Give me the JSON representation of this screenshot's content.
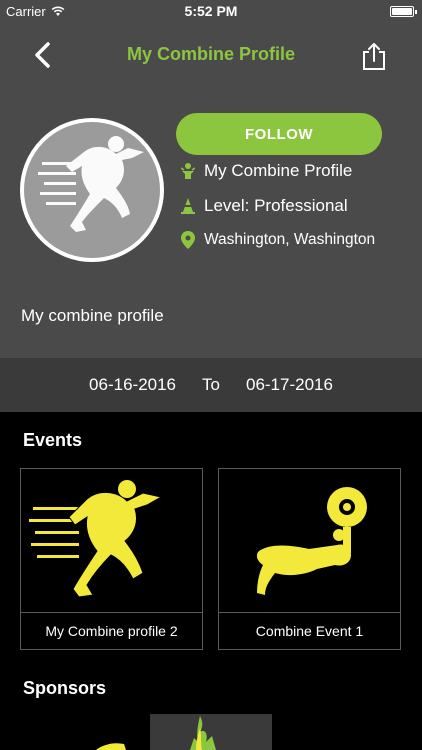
{
  "status_bar": {
    "carrier": "Carrier",
    "time": "5:52 PM"
  },
  "nav": {
    "title": "My Combine Profile",
    "back_icon": "chevron-left-icon",
    "share_icon": "share-icon"
  },
  "profile": {
    "follow_label": "FOLLOW",
    "name": "My  Combine Profile",
    "level": "Level: Professional",
    "location": "Washington, Washington",
    "description": "My combine profile"
  },
  "date_range": {
    "start": "06-16-2016",
    "separator": "To",
    "end": "06-17-2016"
  },
  "events": {
    "title": "Events",
    "items": [
      {
        "label": "My Combine profile 2",
        "icon": "sprinter-icon"
      },
      {
        "label": "Combine Event 1",
        "icon": "weightlifter-icon"
      }
    ]
  },
  "sponsors": {
    "title": "Sponsors"
  },
  "colors": {
    "accent": "#8cc63f",
    "header_bg": "#4a4a4a",
    "icon_yellow": "#f2e93a",
    "avatar_bg": "#9b9b9b"
  }
}
